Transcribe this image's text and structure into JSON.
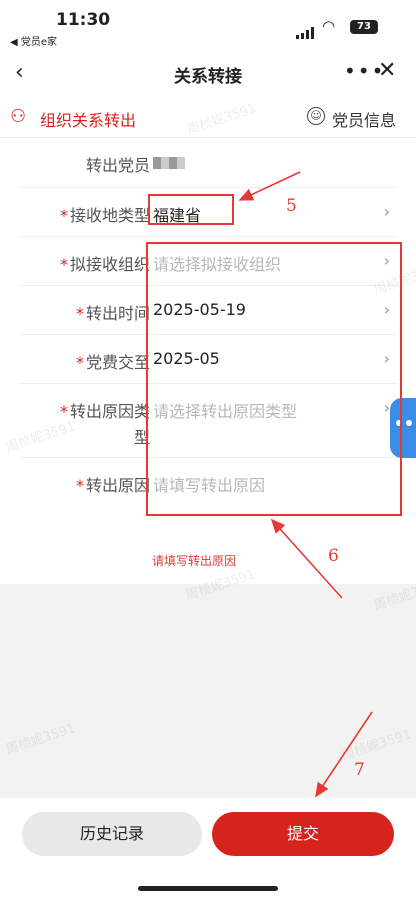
{
  "status": {
    "time": "11:30",
    "back_app": "◀ 党员e家",
    "battery": "73"
  },
  "nav": {
    "title": "关系转接",
    "more": "•••"
  },
  "section": {
    "title": "组织关系转出",
    "member_info": "党员信息"
  },
  "form": {
    "rows": [
      {
        "label": "转出党员",
        "required": false,
        "value": "",
        "masked": true,
        "chevron": false
      },
      {
        "label": "接收地类型",
        "required": true,
        "value": "福建省",
        "chevron": true
      },
      {
        "label": "拟接收组织",
        "required": true,
        "value": "请选择拟接收组织",
        "placeholder": true,
        "chevron": true
      },
      {
        "label": "转出时间",
        "required": true,
        "value": "2025-05-19",
        "chevron": true
      },
      {
        "label": "党费交至",
        "required": true,
        "value": "2025-05",
        "chevron": true
      },
      {
        "label": "转出原因类",
        "label_line2": "型",
        "required": true,
        "value": "请选择转出原因类型",
        "placeholder": true,
        "chevron": true
      },
      {
        "label": "转出原因",
        "required": true,
        "value": "请填写转出原因",
        "placeholder": true,
        "chevron": false
      }
    ]
  },
  "annotations": {
    "step5": "5",
    "step6": "6",
    "step7": "7",
    "note": "请填写转出原因",
    "color": "#e53935"
  },
  "watermark": "周桢妮3591",
  "buttons": {
    "history": "历史记录",
    "submit": "提交"
  },
  "colors": {
    "brand": "#d6241c",
    "placeholder": "#b8b8b8"
  }
}
